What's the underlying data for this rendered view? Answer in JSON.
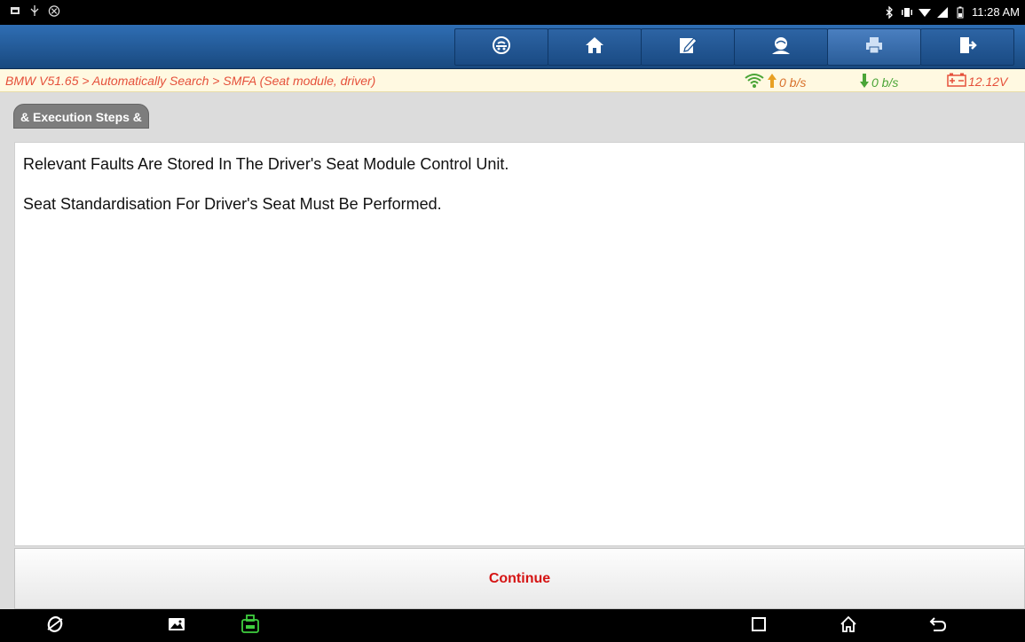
{
  "status_bar": {
    "time": "11:28 AM",
    "left_icons": [
      "notification-icon",
      "usb-icon",
      "settings-ring-icon"
    ],
    "right_icons": [
      "bluetooth-icon",
      "vibrate-icon",
      "wifi-icon",
      "signal-icon",
      "battery-icon"
    ]
  },
  "toolbar": {
    "buttons": [
      "vehicle-icon",
      "home-icon",
      "edit-report-icon",
      "support-icon",
      "print-icon",
      "exit-icon"
    ]
  },
  "breadcrumb": {
    "text": "BMW V51.65 > Automatically Search > SMFA (Seat module, driver)",
    "upload": "0 b/s",
    "download": "0 b/s",
    "battery": "12.12V"
  },
  "panel": {
    "tab_label": "& Execution Steps &",
    "lines": [
      "Relevant Faults Are Stored In The Driver's Seat Module Control Unit.",
      "Seat Standardisation For Driver's Seat Must Be Performed."
    ],
    "continue_label": "Continue"
  },
  "colors": {
    "toolbar": "#1f5594",
    "breadcrumb_text": "#e5503a",
    "continue_text": "#d51414",
    "upload": "#d8702a",
    "download": "#4aa537"
  },
  "nav_bar": {
    "icons": [
      "browser-icon",
      "gallery-icon",
      "vci-icon",
      "recents-icon",
      "home-nav-icon",
      "back-icon"
    ]
  }
}
